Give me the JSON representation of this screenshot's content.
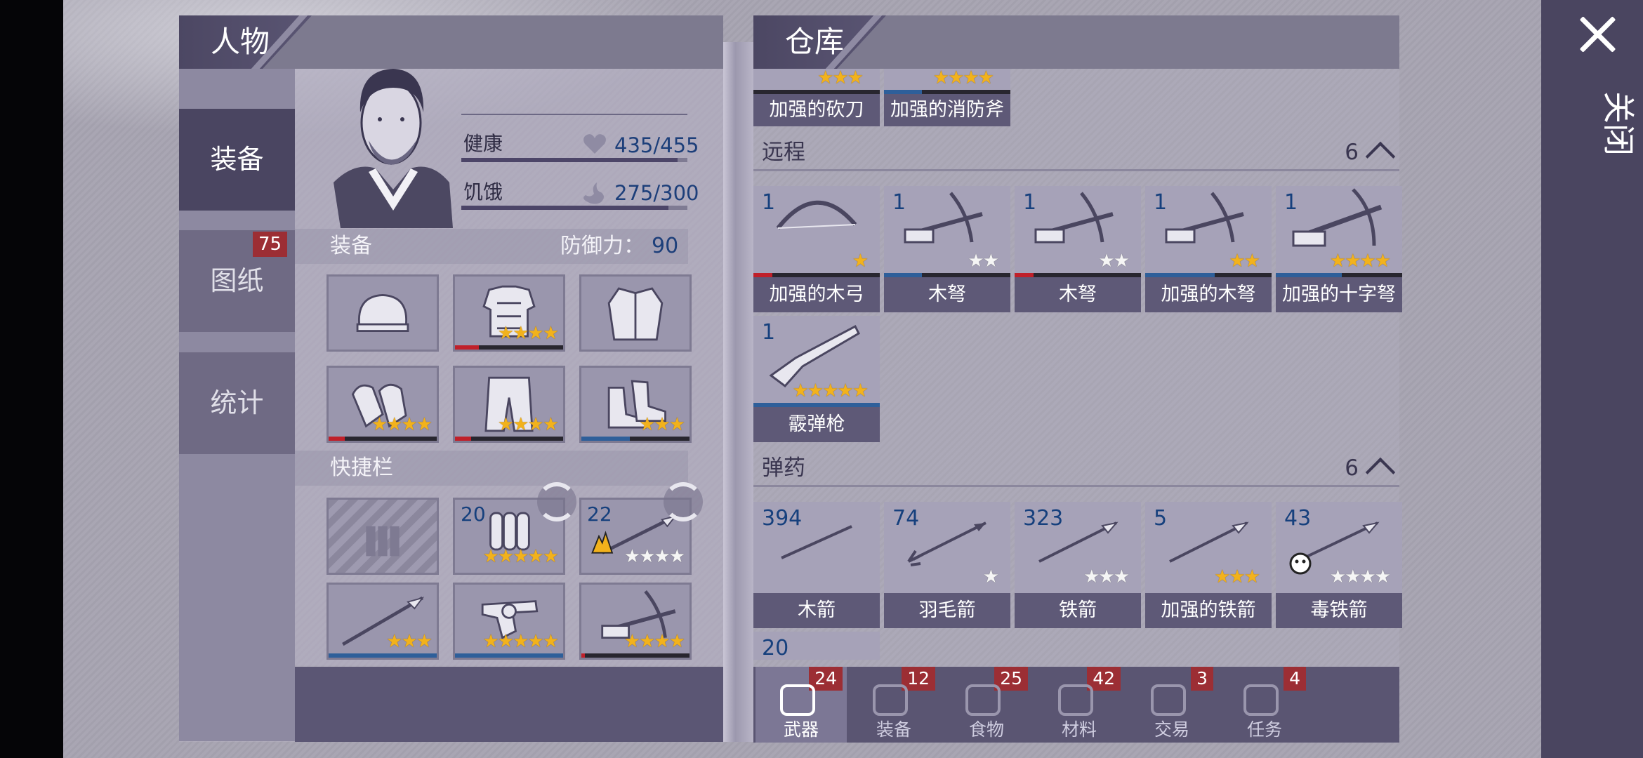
{
  "window": {
    "close_label": "关闭"
  },
  "character": {
    "title": "人物",
    "tabs": [
      {
        "label": "装备",
        "active": true
      },
      {
        "label": "图纸",
        "badge": "75"
      },
      {
        "label": "统计"
      }
    ],
    "stats": {
      "health_label": "健康",
      "health_value": "435/455",
      "health_fraction": 0.956,
      "hunger_label": "饥饿",
      "hunger_value": "275/300",
      "hunger_fraction": 0.917
    },
    "equipment": {
      "label": "装备",
      "defense_label": "防御力：",
      "defense_value": "90",
      "slots": [
        {
          "icon": "hat-icon",
          "stars": 0,
          "durability": 0
        },
        {
          "icon": "body-armor-icon",
          "stars": 4,
          "durability": 0.22,
          "bar_color": "#c0202a"
        },
        {
          "icon": "jacket-icon",
          "stars": 0,
          "durability": 0
        },
        {
          "icon": "gloves-icon",
          "stars": 4,
          "durability": 0.15,
          "bar_color": "#c0202a"
        },
        {
          "icon": "pants-icon",
          "stars": 4,
          "durability": 0.15,
          "bar_color": "#c0202a"
        },
        {
          "icon": "boots-icon",
          "stars": 3,
          "durability": 0.45,
          "bar_color": "#2e5f9a"
        }
      ]
    },
    "quickbar": {
      "label": "快捷栏",
      "slots": [
        {
          "icon": "ammo-placeholder-icon",
          "empty": true
        },
        {
          "icon": "gas-canisters-icon",
          "count": "20",
          "stars": 5,
          "swap": true
        },
        {
          "icon": "spear-fire-icon",
          "count": "22",
          "stars": 4,
          "gold": 0,
          "swap": true
        },
        {
          "icon": "spear-icon",
          "stars": 3,
          "durability": 1.0,
          "bar_color": "#2e5f9a"
        },
        {
          "icon": "revolver-icon",
          "stars": 5,
          "durability": 1.0,
          "bar_color": "#2e5f9a"
        },
        {
          "icon": "crossbow-icon",
          "stars": 4,
          "durability": 0.03,
          "bar_color": "#c0202a"
        }
      ]
    }
  },
  "storage": {
    "title": "仓库",
    "melee_partial": [
      {
        "label": "加强的砍刀",
        "stars": 3
      },
      {
        "label": "加强的消防斧",
        "stars": 4
      }
    ],
    "ranged": {
      "label": "远程",
      "count": "6",
      "items": [
        {
          "count": "1",
          "label": "加强的木弓",
          "icon": "bow-icon",
          "stars": 1,
          "gold": 1,
          "durability": 0.15,
          "bar_color": "#c0202a"
        },
        {
          "count": "1",
          "label": "木弩",
          "icon": "crossbow-icon",
          "stars": 2,
          "gold": 0,
          "durability": 0.3,
          "bar_color": "#2e5f9a"
        },
        {
          "count": "1",
          "label": "木弩",
          "icon": "crossbow-icon",
          "stars": 2,
          "gold": 0,
          "durability": 0.15,
          "bar_color": "#c0202a"
        },
        {
          "count": "1",
          "label": "加强的木弩",
          "icon": "crossbow-icon",
          "stars": 2,
          "gold": 2,
          "durability": 0.55,
          "bar_color": "#2e5f9a"
        },
        {
          "count": "1",
          "label": "加强的十字弩",
          "icon": "heavy-crossbow-icon",
          "stars": 4,
          "gold": 4,
          "durability": 0.52,
          "bar_color": "#2e5f9a"
        },
        {
          "count": "1",
          "label": "霰弹枪",
          "icon": "shotgun-icon",
          "stars": 5,
          "gold": 5,
          "durability": 1.0,
          "bar_color": "#2e5f9a"
        }
      ]
    },
    "ammo": {
      "label": "弹药",
      "count": "6",
      "items": [
        {
          "count": "394",
          "label": "木箭",
          "icon": "wood-arrow-icon",
          "stars": 0,
          "gold": 0
        },
        {
          "count": "74",
          "label": "羽毛箭",
          "icon": "feather-arrow-icon",
          "stars": 1,
          "gold": 0
        },
        {
          "count": "323",
          "label": "铁箭",
          "icon": "iron-arrow-icon",
          "stars": 3,
          "gold": 0
        },
        {
          "count": "5",
          "label": "加强的铁箭",
          "icon": "iron-arrow-icon",
          "stars": 3,
          "gold": 3
        },
        {
          "count": "43",
          "label": "毒铁箭",
          "icon": "poison-arrow-icon",
          "stars": 4,
          "gold": 0
        },
        {
          "count": "20"
        }
      ]
    },
    "bottom_tabs": [
      {
        "label": "武器",
        "badge": "24",
        "icon": "axe-icon",
        "active": true
      },
      {
        "label": "装备",
        "badge": "12",
        "icon": "shirt-icon"
      },
      {
        "label": "食物",
        "badge": "25",
        "icon": "meat-icon"
      },
      {
        "label": "材料",
        "badge": "42",
        "icon": "wood-log-icon"
      },
      {
        "label": "交易",
        "badge": "3",
        "icon": "coin-icon"
      },
      {
        "label": "任务",
        "badge": "4",
        "icon": "key-icon"
      }
    ]
  }
}
